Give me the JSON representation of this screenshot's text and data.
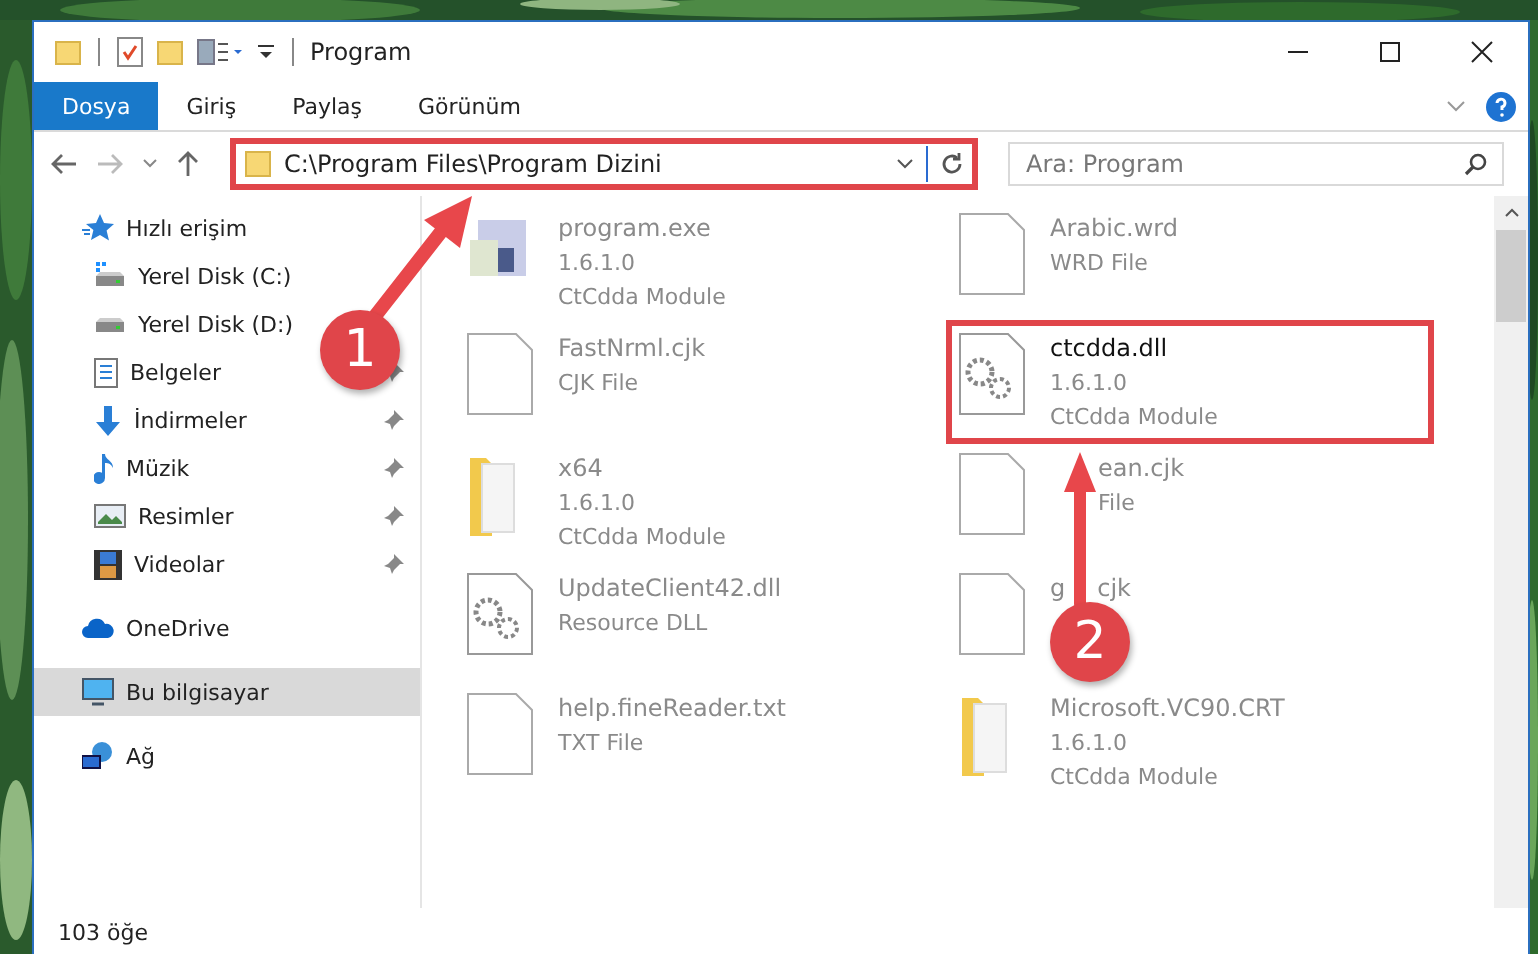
{
  "window": {
    "title": "Program"
  },
  "ribbon_tabs": [
    {
      "label": "Dosya",
      "selected": true
    },
    {
      "label": "Giriş",
      "selected": false
    },
    {
      "label": "Paylaş",
      "selected": false
    },
    {
      "label": "Görünüm",
      "selected": false
    }
  ],
  "address": {
    "path": "C:\\Program Files\\Program Dizini"
  },
  "search": {
    "placeholder": "Ara: Program"
  },
  "sidebar": {
    "items": [
      {
        "label": "Hızlı erişim",
        "kind": "star",
        "pinned": false,
        "selected": false,
        "indent": false
      },
      {
        "label": "Yerel Disk (C:)",
        "kind": "drive-c",
        "pinned": false,
        "selected": false,
        "indent": true
      },
      {
        "label": "Yerel Disk (D:)",
        "kind": "drive",
        "pinned": false,
        "selected": false,
        "indent": true
      },
      {
        "label": "Belgeler",
        "kind": "docs",
        "pinned": true,
        "selected": false,
        "indent": true
      },
      {
        "label": "İndirmeler",
        "kind": "download",
        "pinned": true,
        "selected": false,
        "indent": true
      },
      {
        "label": "Müzik",
        "kind": "music",
        "pinned": true,
        "selected": false,
        "indent": true
      },
      {
        "label": "Resimler",
        "kind": "pictures",
        "pinned": true,
        "selected": false,
        "indent": true
      },
      {
        "label": "Videolar",
        "kind": "videos",
        "pinned": true,
        "selected": false,
        "indent": true
      },
      {
        "label": "OneDrive",
        "kind": "cloud",
        "pinned": false,
        "selected": false,
        "indent": false
      },
      {
        "label": "Bu bilgisayar",
        "kind": "pc",
        "pinned": false,
        "selected": true,
        "indent": false
      },
      {
        "label": "Ağ",
        "kind": "network",
        "pinned": false,
        "selected": false,
        "indent": false
      }
    ]
  },
  "files": [
    {
      "name": "program.exe",
      "details": [
        "1.6.1.0",
        "CtCdda Module"
      ],
      "kind": "exe",
      "faded": true,
      "covered": false,
      "highlighted": false
    },
    {
      "name": "Arabic.wrd",
      "details": [
        "WRD File"
      ],
      "kind": "blank",
      "faded": true,
      "covered": false,
      "highlighted": false
    },
    {
      "name": "FastNrml.cjk",
      "details": [
        "CJK File"
      ],
      "kind": "blank",
      "faded": true,
      "covered": false,
      "highlighted": false
    },
    {
      "name": "ctcdda.dll",
      "details": [
        "1.6.1.0",
        "CtCdda Module"
      ],
      "kind": "dll",
      "faded": false,
      "covered": false,
      "highlighted": true
    },
    {
      "name": "x64",
      "details": [
        "1.6.1.0",
        "CtCdda Module"
      ],
      "kind": "folder",
      "faded": true,
      "covered": false,
      "highlighted": false
    },
    {
      "name": "ean.cjk",
      "details": [
        "File"
      ],
      "kind": "blank",
      "faded": true,
      "covered": true,
      "highlighted": false
    },
    {
      "name": "UpdateClient42.dll",
      "details": [
        "Resource DLL"
      ],
      "kind": "dll",
      "faded": true,
      "covered": false,
      "highlighted": false
    },
    {
      "lead": "g",
      "name": "cjk",
      "kind": "blank",
      "faded": true,
      "covered": true,
      "highlighted": false
    },
    {
      "name": "help.fineReader.txt",
      "details": [
        "TXT File"
      ],
      "kind": "blank",
      "faded": true,
      "covered": false,
      "highlighted": false
    },
    {
      "name": "Microsoft.VC90.CRT",
      "details": [
        "1.6.1.0",
        "CtCdda Module"
      ],
      "kind": "folder",
      "faded": true,
      "covered": false,
      "highlighted": false
    }
  ],
  "status_bar": {
    "count": "103 öğe"
  },
  "annotations": [
    {
      "label": "1"
    },
    {
      "label": "2"
    }
  ]
}
